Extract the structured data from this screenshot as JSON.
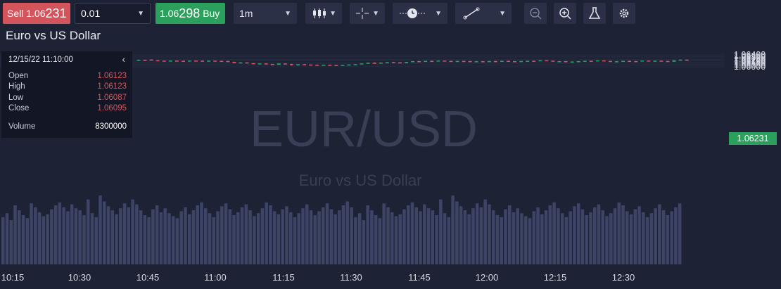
{
  "toolbar": {
    "sell_label": "Sell",
    "sell_price_main": "1.06",
    "sell_price_big": "231",
    "quantity": "0.01",
    "buy_price_main": "1.06",
    "buy_price_big": "298",
    "buy_label": "Buy",
    "timeframe": "1m",
    "icons": [
      "candlestick-icon",
      "crosshair-icon",
      "clock-icon",
      "line-tool-icon",
      "zoom-out-icon",
      "zoom-in-icon",
      "flask-icon",
      "settings-icon"
    ]
  },
  "legend": {
    "title": "Euro vs US Dollar"
  },
  "info_panel": {
    "datetime": "12/15/22 11:10:00",
    "open_label": "Open",
    "open_value": "1.06123",
    "high_label": "High",
    "high_value": "1.06123",
    "low_label": "Low",
    "low_value": "1.06087",
    "close_label": "Close",
    "close_value": "1.06095",
    "volume_label": "Volume",
    "volume_value": "8300000"
  },
  "watermark": {
    "symbol": "EUR/USD",
    "name": "Euro vs US Dollar"
  },
  "current_price": "1.06231",
  "colors": {
    "up": "#2aa05c",
    "down": "#d4545c",
    "volume": "#3d4466",
    "background": "#1e2235"
  },
  "chart_data": {
    "type": "candlestick",
    "title": "Euro vs US Dollar",
    "x_ticks": [
      "10:15",
      "10:30",
      "10:45",
      "11:00",
      "11:15",
      "11:30",
      "11:45",
      "12:00",
      "12:15",
      "12:30"
    ],
    "y_ticks": [
      "1.06400",
      "1.06350",
      "1.06300",
      "1.06250",
      "1.06200",
      "1.06150",
      "1.06100",
      "1.06050",
      "1.06000"
    ],
    "ylim": [
      1.0598,
      1.0642
    ],
    "x_start": "10:45",
    "interval": "1m",
    "candles": [
      [
        1.06214,
        1.06239,
        1.06194,
        1.06231
      ],
      [
        1.06231,
        1.06239,
        1.06219,
        1.06222
      ],
      [
        1.06242,
        1.06249,
        1.06212,
        1.06219
      ],
      [
        1.06219,
        1.06231,
        1.06199,
        1.06206
      ],
      [
        1.06206,
        1.06212,
        1.06188,
        1.06198
      ],
      [
        1.06198,
        1.06221,
        1.06189,
        1.06208
      ],
      [
        1.06208,
        1.06217,
        1.06189,
        1.06201
      ],
      [
        1.06201,
        1.06212,
        1.06187,
        1.06198
      ],
      [
        1.06198,
        1.06213,
        1.06181,
        1.06208
      ],
      [
        1.06208,
        1.06215,
        1.06195,
        1.06204
      ],
      [
        1.06204,
        1.06216,
        1.06183,
        1.06189
      ],
      [
        1.06189,
        1.06212,
        1.06175,
        1.06206
      ],
      [
        1.06206,
        1.06211,
        1.06189,
        1.06198
      ],
      [
        1.06198,
        1.06208,
        1.06183,
        1.06193
      ],
      [
        1.06193,
        1.06205,
        1.06156,
        1.06166
      ],
      [
        1.06166,
        1.06171,
        1.06118,
        1.06125
      ],
      [
        1.06125,
        1.06158,
        1.06118,
        1.06146
      ],
      [
        1.06146,
        1.06151,
        1.06113,
        1.06119
      ],
      [
        1.06119,
        1.06123,
        1.06087,
        1.06095
      ],
      [
        1.06095,
        1.06119,
        1.06088,
        1.06112
      ],
      [
        1.06112,
        1.06121,
        1.06089,
        1.06093
      ],
      [
        1.06093,
        1.06099,
        1.06063,
        1.06068
      ],
      [
        1.06068,
        1.06121,
        1.06061,
        1.06111
      ],
      [
        1.06111,
        1.06114,
        1.06081,
        1.06091
      ],
      [
        1.06091,
        1.06098,
        1.06043,
        1.06053
      ],
      [
        1.06053,
        1.06092,
        1.06031,
        1.06087
      ],
      [
        1.06087,
        1.06094,
        1.06068,
        1.06075
      ],
      [
        1.06075,
        1.06081,
        1.06059,
        1.06066
      ],
      [
        1.06066,
        1.06077,
        1.06043,
        1.06051
      ],
      [
        1.06051,
        1.06072,
        1.06046,
        1.06066
      ],
      [
        1.06066,
        1.06073,
        1.06055,
        1.06061
      ],
      [
        1.06061,
        1.06068,
        1.06046,
        1.06051
      ],
      [
        1.06051,
        1.06069,
        1.06038,
        1.06063
      ],
      [
        1.06063,
        1.06081,
        1.06056,
        1.06076
      ],
      [
        1.06076,
        1.06092,
        1.06069,
        1.06087
      ],
      [
        1.06087,
        1.06118,
        1.06081,
        1.06112
      ],
      [
        1.06112,
        1.06141,
        1.06106,
        1.06134
      ],
      [
        1.06134,
        1.06152,
        1.06118,
        1.06127
      ],
      [
        1.06127,
        1.06144,
        1.06113,
        1.06138
      ],
      [
        1.06138,
        1.06162,
        1.06131,
        1.06155
      ],
      [
        1.06155,
        1.06168,
        1.06143,
        1.06149
      ],
      [
        1.06149,
        1.06152,
        1.06113,
        1.06121
      ],
      [
        1.06121,
        1.06167,
        1.06116,
        1.06162
      ],
      [
        1.06162,
        1.06195,
        1.06158,
        1.06188
      ],
      [
        1.06188,
        1.06196,
        1.06172,
        1.06179
      ],
      [
        1.06179,
        1.06204,
        1.06173,
        1.06198
      ],
      [
        1.06198,
        1.06211,
        1.06186,
        1.06192
      ],
      [
        1.06192,
        1.06215,
        1.06188,
        1.06208
      ],
      [
        1.06208,
        1.06213,
        1.06191,
        1.06197
      ],
      [
        1.06197,
        1.06202,
        1.06174,
        1.06183
      ],
      [
        1.06183,
        1.06202,
        1.06178,
        1.06196
      ],
      [
        1.06196,
        1.06203,
        1.06186,
        1.06191
      ],
      [
        1.06191,
        1.06198,
        1.06155,
        1.06164
      ],
      [
        1.06164,
        1.06192,
        1.06158,
        1.06186
      ],
      [
        1.06186,
        1.06191,
        1.06168,
        1.06172
      ],
      [
        1.06172,
        1.06197,
        1.06166,
        1.06191
      ],
      [
        1.06191,
        1.06201,
        1.06174,
        1.06178
      ],
      [
        1.06178,
        1.06205,
        1.06172,
        1.06199
      ],
      [
        1.06199,
        1.06204,
        1.06183,
        1.06188
      ],
      [
        1.06188,
        1.06193,
        1.06171,
        1.06176
      ],
      [
        1.06176,
        1.06198,
        1.06171,
        1.06193
      ],
      [
        1.06193,
        1.06207,
        1.06185,
        1.06201
      ],
      [
        1.06201,
        1.06209,
        1.06189,
        1.06195
      ],
      [
        1.06195,
        1.06226,
        1.06192,
        1.06219
      ],
      [
        1.06219,
        1.06224,
        1.06198,
        1.06204
      ],
      [
        1.06204,
        1.06208,
        1.06176,
        1.06182
      ],
      [
        1.06182,
        1.06193,
        1.06171,
        1.06188
      ],
      [
        1.06188,
        1.06192,
        1.06147,
        1.06158
      ],
      [
        1.06158,
        1.06181,
        1.06151,
        1.06175
      ],
      [
        1.06175,
        1.06194,
        1.06168,
        1.06188
      ],
      [
        1.06188,
        1.06206,
        1.06182,
        1.06201
      ],
      [
        1.06201,
        1.06209,
        1.06186,
        1.06192
      ],
      [
        1.06192,
        1.06221,
        1.06187,
        1.06214
      ],
      [
        1.06214,
        1.06219,
        1.06191,
        1.06196
      ],
      [
        1.06196,
        1.06201,
        1.06171,
        1.06178
      ],
      [
        1.06178,
        1.06192,
        1.06168,
        1.06185
      ],
      [
        1.06185,
        1.06205,
        1.06181,
        1.06199
      ],
      [
        1.06199,
        1.06206,
        1.06186,
        1.06191
      ],
      [
        1.06191,
        1.06198,
        1.06172,
        1.06178
      ],
      [
        1.06178,
        1.06214,
        1.06173,
        1.06209
      ],
      [
        1.06209,
        1.06214,
        1.06178,
        1.06186
      ],
      [
        1.06186,
        1.06212,
        1.06179,
        1.06205
      ],
      [
        1.06205,
        1.06211,
        1.06189,
        1.06194
      ],
      [
        1.06194,
        1.06198,
        1.06159,
        1.06168
      ],
      [
        1.06168,
        1.06224,
        1.06163,
        1.06219
      ],
      [
        1.06219,
        1.06246,
        1.06212,
        1.06239
      ],
      [
        1.06239,
        1.06244,
        1.06222,
        1.06231
      ]
    ],
    "volumes": [
      48,
      52,
      45,
      60,
      55,
      50,
      47,
      62,
      58,
      53,
      49,
      51,
      56,
      60,
      63,
      58,
      54,
      61,
      57,
      55,
      50,
      66,
      52,
      48,
      70,
      64,
      59,
      55,
      51,
      57,
      62,
      58,
      66,
      61,
      55,
      50,
      48,
      56,
      60,
      53,
      57,
      52,
      49,
      47,
      54,
      58,
      51,
      55,
      60,
      63,
      57,
      52,
      48,
      54,
      59,
      62,
      56,
      50,
      53,
      58,
      61,
      55,
      49,
      52,
      57,
      63,
      60,
      54,
      51,
      56,
      59,
      53,
      48,
      52,
      57,
      61,
      55,
      50,
      54,
      58,
      62,
      56,
      51,
      55,
      60,
      64,
      58
    ]
  }
}
